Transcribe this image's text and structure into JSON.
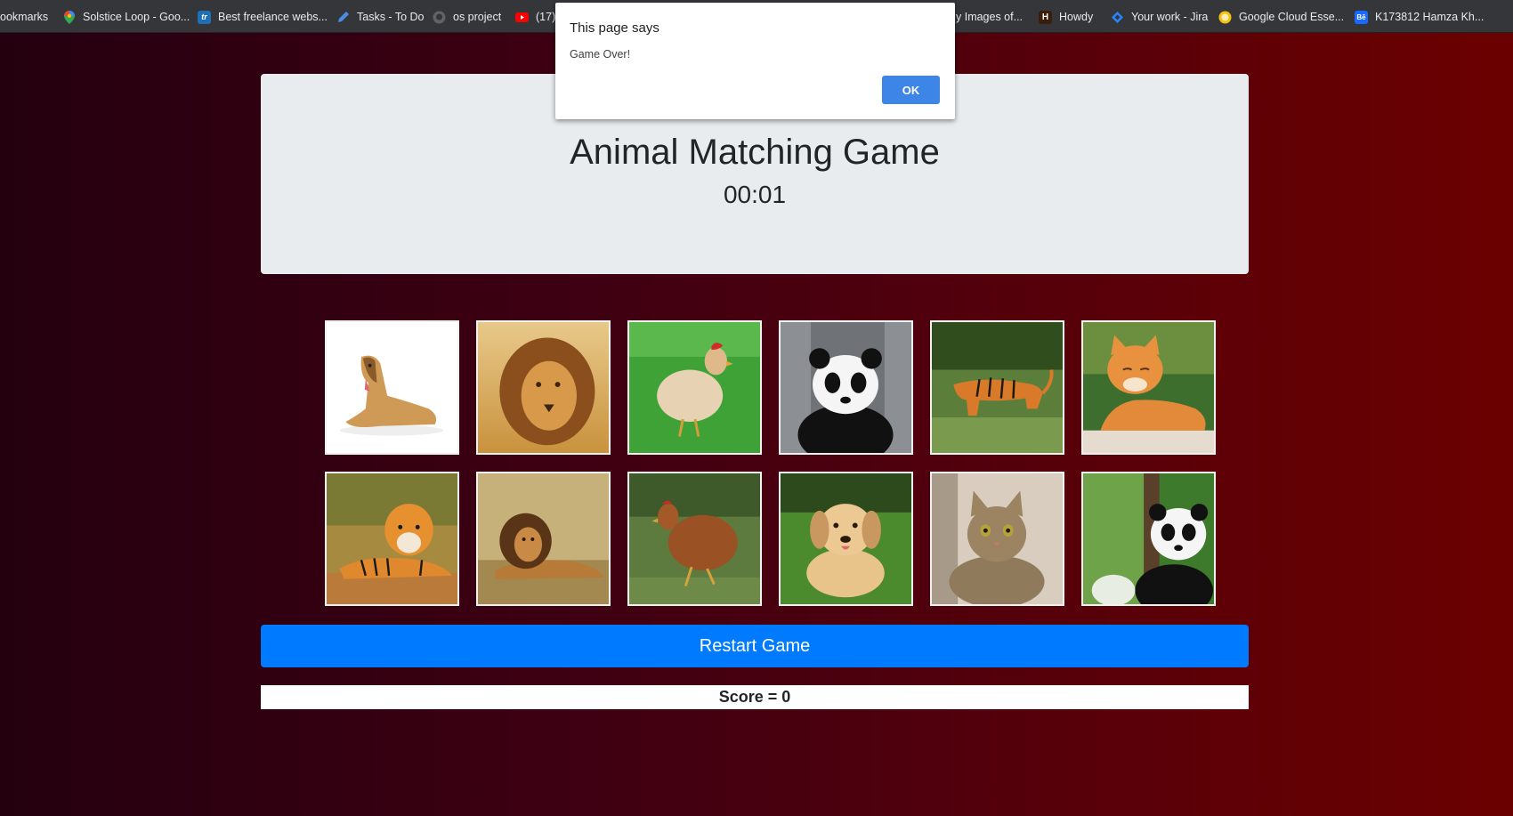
{
  "bookmarks": [
    {
      "label": "ookmarks",
      "icon": "bookmarks-icon",
      "color": "#35363a"
    },
    {
      "label": "Solstice Loop - Goo...",
      "icon": "maps-pin-icon",
      "color": "#34a853"
    },
    {
      "label": "Best freelance webs...",
      "icon": "tr-logo-icon",
      "color": "#1f6fb5"
    },
    {
      "label": "Tasks - To Do",
      "icon": "pencil-icon",
      "color": "#4a90e2"
    },
    {
      "label": "os project",
      "icon": "github-icon",
      "color": "#5f6368"
    },
    {
      "label": "(17)",
      "icon": "youtube-icon",
      "color": "#ff0000"
    },
    {
      "label": "y Images of...",
      "icon": "images-icon",
      "color": "#35363a"
    },
    {
      "label": "Howdy",
      "icon": "howdy-h-icon",
      "color": "#5a2e0e"
    },
    {
      "label": "Your work - Jira",
      "icon": "jira-icon",
      "color": "#2684ff"
    },
    {
      "label": "Google Cloud Esse...",
      "icon": "google-cloud-icon",
      "color": "#f4c20d"
    },
    {
      "label": "K173812 Hamza Kh...",
      "icon": "behance-icon",
      "color": "#1769ff"
    }
  ],
  "header": {
    "title": "Animal Matching Game",
    "timer": "00:01"
  },
  "cards": [
    {
      "animal": "dog"
    },
    {
      "animal": "lion"
    },
    {
      "animal": "chicken"
    },
    {
      "animal": "panda"
    },
    {
      "animal": "tiger"
    },
    {
      "animal": "cat"
    },
    {
      "animal": "tiger"
    },
    {
      "animal": "lion"
    },
    {
      "animal": "chicken"
    },
    {
      "animal": "dog"
    },
    {
      "animal": "cat"
    },
    {
      "animal": "panda"
    }
  ],
  "controls": {
    "restart_label": "Restart Game",
    "score_text": "Score = 0"
  },
  "dialog": {
    "title": "This page says",
    "message": "Game Over!",
    "ok_label": "OK"
  },
  "colors": {
    "button_primary": "#007bff",
    "dialog_ok": "#3d86e8",
    "jumbotron": "#e9ecef"
  }
}
